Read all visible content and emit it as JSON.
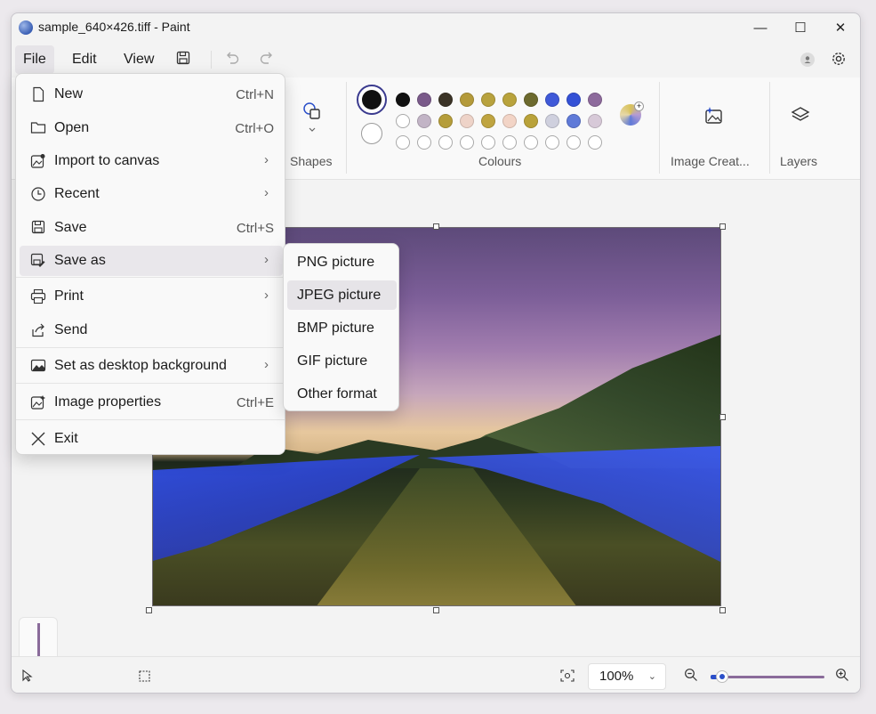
{
  "window": {
    "title": "sample_640×426.tiff - Paint"
  },
  "window_controls": {
    "minimize": "—",
    "maximize": "☐",
    "close": "✕"
  },
  "menubar": {
    "file": "File",
    "edit": "Edit",
    "view": "View"
  },
  "ribbon": {
    "shapes_label": "Shapes",
    "colours_label": "Colours",
    "image_creator_label": "Image Creat...",
    "layers_label": "Layers"
  },
  "colours": {
    "primary": "#111111",
    "secondary": "#ffffff",
    "row1": [
      "#111111",
      "#7a5a8a",
      "#3b3326",
      "#b49a3a",
      "#b8a23e",
      "#b9a33c",
      "#6d6a2e",
      "#3f59d8",
      "#3451d6",
      "#8d6a9c"
    ],
    "row2": [
      "#ffffff",
      "#c2b4c6",
      "#b59d3a",
      "#eed3c8",
      "#bfa440",
      "#f2d4c6",
      "#b9a23a",
      "#cfd0de",
      "#5f7ad8",
      "#d7c9d8"
    ]
  },
  "file_menu": {
    "items": [
      {
        "label": "New",
        "shortcut": "Ctrl+N",
        "icon": "new-file-icon"
      },
      {
        "label": "Open",
        "shortcut": "Ctrl+O",
        "icon": "folder-icon"
      },
      {
        "label": "Import to canvas",
        "shortcut": "",
        "icon": "import-icon"
      },
      {
        "label": "Recent",
        "shortcut": "",
        "icon": "clock-icon"
      },
      {
        "label": "Save",
        "shortcut": "Ctrl+S",
        "icon": "save-icon"
      },
      {
        "label": "Save as",
        "shortcut": "",
        "icon": "save-as-icon"
      },
      {
        "label": "Print",
        "shortcut": "",
        "icon": "printer-icon"
      },
      {
        "label": "Send",
        "shortcut": "",
        "icon": "share-icon"
      },
      {
        "label": "Set as desktop background",
        "shortcut": "",
        "icon": "desktop-icon"
      },
      {
        "label": "Image properties",
        "shortcut": "Ctrl+E",
        "icon": "image-properties-icon"
      },
      {
        "label": "Exit",
        "shortcut": "",
        "icon": "close-icon"
      }
    ]
  },
  "save_as_menu": {
    "items": [
      "PNG picture",
      "JPEG picture",
      "BMP picture",
      "GIF picture",
      "Other format"
    ]
  },
  "statusbar": {
    "zoom": "100%",
    "zoom_level": 0.1
  }
}
